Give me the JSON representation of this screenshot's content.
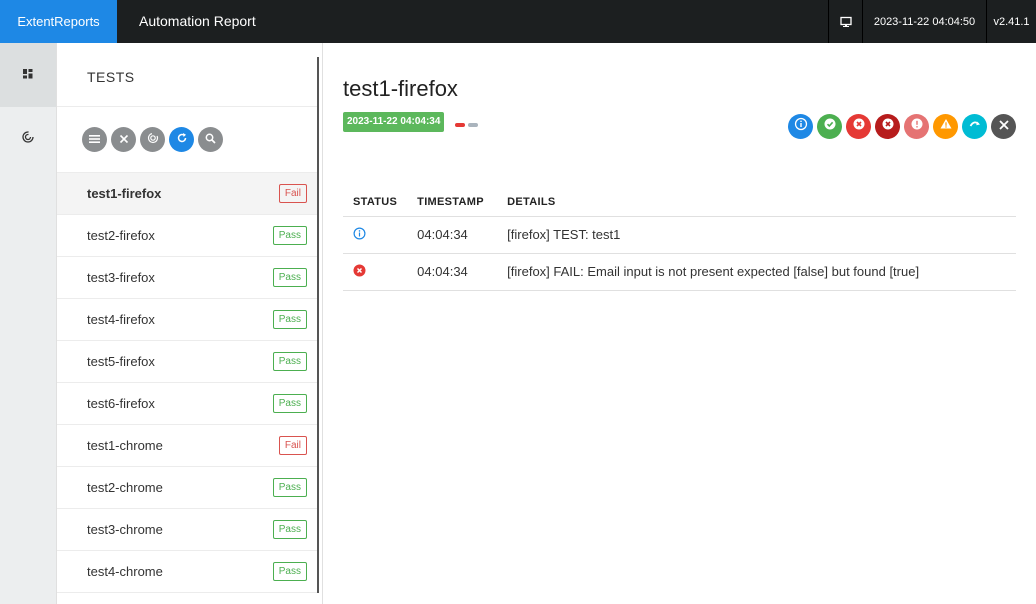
{
  "navbar": {
    "brand": "ExtentReports",
    "report_name": "Automation Report",
    "datetime": "2023-11-22 04:04:50",
    "version": "v2.41.1"
  },
  "sidebar": {
    "items": [
      {
        "icon": "dashboard-icon",
        "active": true
      },
      {
        "icon": "chart-icon",
        "active": false
      }
    ]
  },
  "test_list": {
    "title": "TESTS",
    "tools": [
      "list-icon",
      "close-icon",
      "fingerprint-icon",
      "refresh-icon",
      "search-icon"
    ],
    "items": [
      {
        "name": "test1-firefox",
        "status": "Fail",
        "active": true
      },
      {
        "name": "test2-firefox",
        "status": "Pass"
      },
      {
        "name": "test3-firefox",
        "status": "Pass"
      },
      {
        "name": "test4-firefox",
        "status": "Pass"
      },
      {
        "name": "test5-firefox",
        "status": "Pass"
      },
      {
        "name": "test6-firefox",
        "status": "Pass"
      },
      {
        "name": "test1-chrome",
        "status": "Fail"
      },
      {
        "name": "test2-chrome",
        "status": "Pass"
      },
      {
        "name": "test3-chrome",
        "status": "Pass"
      },
      {
        "name": "test4-chrome",
        "status": "Pass"
      }
    ]
  },
  "detail": {
    "test_name": "test1-firefox",
    "start_time": "2023-11-22 04:04:34",
    "status_filters": [
      {
        "icon": "info-icon",
        "color": "#1e88e5"
      },
      {
        "icon": "pass-check-icon",
        "color": "#4caf50"
      },
      {
        "icon": "fail-x-icon",
        "color": "#e53935"
      },
      {
        "icon": "fatal-x-icon",
        "color": "#b71c1c"
      },
      {
        "icon": "error-exclamation-icon",
        "color": "#e57373"
      },
      {
        "icon": "warning-icon",
        "color": "#ff9800"
      },
      {
        "icon": "skip-icon",
        "color": "#00bcd4"
      },
      {
        "icon": "clear-filter-icon",
        "color": "#555555"
      }
    ],
    "columns": {
      "status": "STATUS",
      "timestamp": "TIMESTAMP",
      "details": "DETAILS"
    },
    "logs": [
      {
        "status": "info",
        "timestamp": "04:04:34",
        "details": "[firefox] TEST: test1"
      },
      {
        "status": "fail",
        "timestamp": "04:04:34",
        "details": "[firefox] FAIL: Email input is not present expected [false] but found [true]"
      }
    ]
  },
  "colors": {
    "brand": "#1e88e5",
    "navbar": "#1c1f20",
    "pass": "#4caf50",
    "fail": "#d9534f"
  }
}
